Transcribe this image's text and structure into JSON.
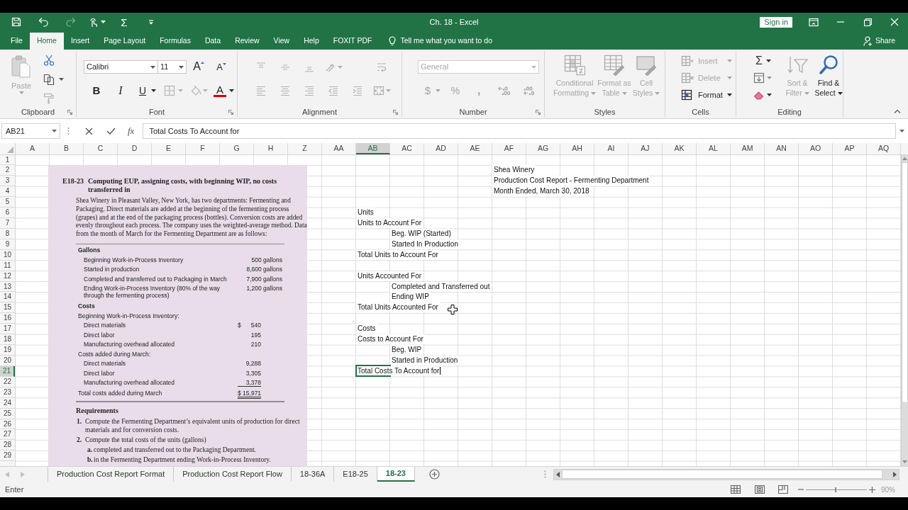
{
  "window": {
    "title": "Ch. 18 - Excel",
    "sign_in": "Sign in"
  },
  "quick_access": {
    "redo": {
      "disabled": true
    },
    "autosum": "Σ"
  },
  "menu_tabs": [
    {
      "label": "File",
      "selected": false
    },
    {
      "label": "Home",
      "selected": true
    },
    {
      "label": "Insert",
      "selected": false
    },
    {
      "label": "Page Layout",
      "selected": false
    },
    {
      "label": "Formulas",
      "selected": false
    },
    {
      "label": "Data",
      "selected": false
    },
    {
      "label": "Review",
      "selected": false
    },
    {
      "label": "View",
      "selected": false
    },
    {
      "label": "Help",
      "selected": false
    },
    {
      "label": "FOXIT PDF",
      "selected": false
    }
  ],
  "tell_me": "Tell me what you want to do",
  "share": "Share",
  "ribbon": {
    "clipboard": {
      "label": "Clipboard",
      "paste": {
        "label": "Paste",
        "disabled": true
      },
      "format_painter": {
        "disabled": true
      }
    },
    "font": {
      "label": "Font",
      "font_name": "Calibri",
      "font_size": "11",
      "grow": "A",
      "shrink": "A",
      "bold": "B",
      "italic": "I",
      "underline": "U",
      "borders": {
        "disabled": true
      },
      "fill_color": {
        "disabled": true
      },
      "font_color": "A"
    },
    "alignment": {
      "label": "Alignment",
      "disabled": true
    },
    "number": {
      "label": "Number",
      "format": "General",
      "currency": "$",
      "percent": "%",
      "comma": ",",
      "disabled": true
    },
    "styles": {
      "label": "Styles",
      "buttons": [
        {
          "kind": "conditional",
          "label": "Conditional Formatting",
          "disabled": true
        },
        {
          "kind": "table",
          "label": "Format as Table",
          "disabled": true
        },
        {
          "kind": "cell_styles",
          "label": "Cell Styles",
          "disabled": true
        }
      ]
    },
    "cells": {
      "label": "Cells",
      "buttons": [
        {
          "kind": "insert",
          "label": "Insert",
          "disabled": true
        },
        {
          "kind": "delete",
          "label": "Delete",
          "disabled": true
        },
        {
          "kind": "format",
          "label": "Format",
          "disabled": false
        }
      ]
    },
    "editing": {
      "label": "Editing",
      "autosum": "Σ",
      "buttons": [
        {
          "kind": "sort",
          "label": "Sort & Filter",
          "disabled": true
        },
        {
          "kind": "find",
          "label": "Find & Select",
          "disabled": false
        }
      ]
    }
  },
  "formula_bar": {
    "name_box": "AB21",
    "function_label": "fx",
    "formula": "Total Costs To Account for"
  },
  "sheet": {
    "columns": [
      "A",
      "B",
      "C",
      "D",
      "E",
      "F",
      "G",
      "H",
      "Z",
      "AA",
      "AB",
      "AC",
      "AD",
      "AE",
      "AF",
      "AG",
      "AH",
      "AI",
      "AJ",
      "AK",
      "AL",
      "AM",
      "AN",
      "AO",
      "AP",
      "AQ"
    ],
    "editing": true,
    "rows": [
      {
        "number": "1"
      },
      {
        "number": "2",
        "cells": [
          {
            "kind": "heading",
            "text": "Shea Winery",
            "selected": false
          }
        ]
      },
      {
        "number": "3",
        "cells": [
          {
            "kind": "heading",
            "text": "Production Cost Report - Fermenting Department",
            "selected": false
          }
        ]
      },
      {
        "number": "4",
        "cells": [
          {
            "kind": "heading",
            "text": "Month Ended, March 30, 2018",
            "selected": false
          }
        ]
      },
      {
        "number": "5"
      },
      {
        "number": "6",
        "cells": [
          {
            "kind": "label",
            "text": "Units",
            "selected": false
          }
        ]
      },
      {
        "number": "7",
        "cells": [
          {
            "kind": "label",
            "text": "Units to Account For",
            "selected": false
          }
        ]
      },
      {
        "number": "8",
        "cells": [
          {
            "kind": "item",
            "text": "Beg. WIP (Started)",
            "selected": false
          }
        ]
      },
      {
        "number": "9",
        "cells": [
          {
            "kind": "item",
            "text": "Started In Production",
            "selected": false
          }
        ]
      },
      {
        "number": "10",
        "cells": [
          {
            "kind": "label",
            "text": "Total Units to Account For",
            "selected": false
          }
        ]
      },
      {
        "number": "11"
      },
      {
        "number": "12",
        "cells": [
          {
            "kind": "label",
            "text": "Units Accounted For",
            "selected": false
          }
        ]
      },
      {
        "number": "13",
        "cells": [
          {
            "kind": "item",
            "text": "Completed and Transferred out",
            "selected": false
          }
        ]
      },
      {
        "number": "14",
        "cells": [
          {
            "kind": "item",
            "text": "Ending WIP",
            "selected": false
          }
        ]
      },
      {
        "number": "15",
        "cells": [
          {
            "kind": "label",
            "text": "Total Units Accounted For",
            "selected": false
          }
        ]
      },
      {
        "number": "16"
      },
      {
        "number": "17",
        "cells": [
          {
            "kind": "label",
            "text": "Costs",
            "selected": false
          }
        ]
      },
      {
        "number": "18",
        "cells": [
          {
            "kind": "label",
            "text": "Costs to Account For",
            "selected": false
          }
        ]
      },
      {
        "number": "19",
        "cells": [
          {
            "kind": "item",
            "text": "Beg. WIP",
            "selected": false
          }
        ]
      },
      {
        "number": "20",
        "cells": [
          {
            "kind": "item",
            "text": "Started in Production",
            "selected": false
          }
        ]
      },
      {
        "number": "21",
        "cells": [
          {
            "kind": "label",
            "text": "Total Costs To Account for",
            "selected": true
          }
        ]
      },
      {
        "number": "22"
      },
      {
        "number": "23"
      },
      {
        "number": "24"
      },
      {
        "number": "25"
      },
      {
        "number": "26"
      },
      {
        "number": "27"
      },
      {
        "number": "28"
      },
      {
        "number": "29"
      }
    ]
  },
  "excerpt": {
    "number": "E18-23",
    "title": "Computing EUP, assigning costs, with beginning WIP, no costs transferred in",
    "paragraph": "Shea Winery in Pleasant Valley, New York, has two departments: Fermenting and Packaging. Direct materials are added at the beginning of the fermenting process (grapes) and at the end of the packaging process (bottles). Conversion costs are added evenly throughout each process. The company uses the weighted-average method. Data from the month of March for the Fermenting Department are as follows:",
    "table": [
      {
        "kind": "heading",
        "label": "Gallons",
        "children": [
          {
            "label": "Beginning Work-in-Process Inventory",
            "value": "500 gallons",
            "underlined": false
          },
          {
            "label": "Started in production",
            "value": "8,600 gallons",
            "underlined": false
          },
          {
            "label": "Completed and transferred out to Packaging in March",
            "value": "7,900 gallons",
            "underlined": false
          },
          {
            "label": "Ending Work-in-Process Inventory (80% of the way through the fermenting process)",
            "value": "1,200 gallons",
            "underlined": false
          }
        ]
      },
      {
        "kind": "heading",
        "label": "Costs"
      },
      {
        "kind": "group",
        "label": "Beginning Work-in-Process Inventory:",
        "children": [
          {
            "label": "Direct materials",
            "currency": "$",
            "value": "540",
            "underlined": false
          },
          {
            "label": "Direct labor",
            "value": "195",
            "underlined": false
          },
          {
            "label": "Manufacturing overhead allocated",
            "value": "210",
            "underlined": false
          }
        ]
      },
      {
        "kind": "group",
        "label": "Costs added during March:",
        "children": [
          {
            "label": "Direct materials",
            "value": "9,288",
            "underlined": false
          },
          {
            "label": "Direct labor",
            "value": "3,305",
            "underlined": false
          },
          {
            "label": "Manufacturing overhead allocated",
            "value": "3,378",
            "underlined": true
          }
        ]
      },
      {
        "kind": "total",
        "label": "Total costs added during March",
        "value": "$ 15,971"
      }
    ],
    "requirements_title": "Requirements",
    "requirements": [
      {
        "number": "1.",
        "text": "Compute the Fermenting Department’s equivalent units of production for direct materials and for conversion costs."
      },
      {
        "number": "2.",
        "text": "Compute the total costs of the units (gallons)",
        "children": [
          {
            "number": "a.",
            "text": "completed and transferred out to the Packaging Department."
          },
          {
            "number": "b.",
            "text": "in the Fermenting Department ending Work-in-Process Inventory."
          }
        ]
      }
    ]
  },
  "sheet_tabs": [
    {
      "label": "Production Cost Report Format",
      "selected": false
    },
    {
      "label": "Production Cost Report Flow",
      "selected": false
    },
    {
      "label": "18-36A",
      "selected": false
    },
    {
      "label": "E18-25",
      "selected": false
    },
    {
      "label": "18-23",
      "selected": true
    }
  ],
  "status_bar": {
    "mode": "Enter",
    "zoom_slider": {
      "level": 0.49
    },
    "zoom": "90%"
  }
}
